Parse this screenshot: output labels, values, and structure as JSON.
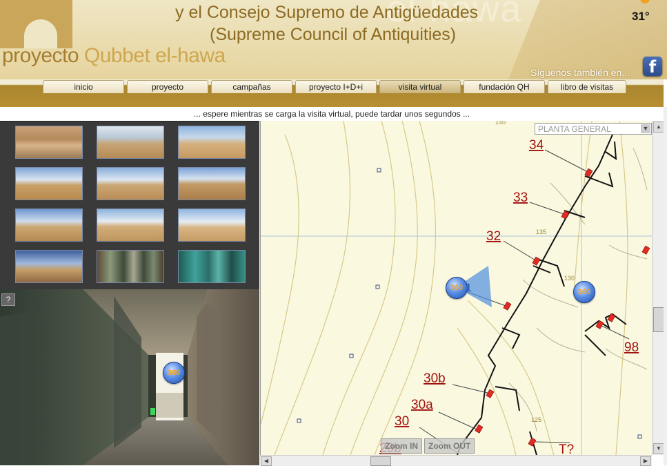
{
  "header": {
    "title_line1": "y el Consejo Supremo de Antigüedades",
    "title_line2": "(Supreme Council of Antiquities)",
    "logo_part1": "proyecto ",
    "logo_part2": "Qubbet el-hawa",
    "temperature": "31°",
    "follow_text": "Síguenos también en...",
    "facebook_glyph": "f"
  },
  "nav": {
    "tabs": [
      {
        "label": "inicio",
        "active": false
      },
      {
        "label": "proyecto",
        "active": false
      },
      {
        "label": "campañas",
        "active": false
      },
      {
        "label": "proyecto I+D+i",
        "active": false
      },
      {
        "label": "visita virtual",
        "active": true
      },
      {
        "label": "fundación QH",
        "active": false
      },
      {
        "label": "libro de visitas",
        "active": false
      }
    ]
  },
  "loading_message": "... espere mientras se carga la visita virtual, puede tardar unos segundos ...",
  "help_label": "?",
  "map": {
    "select_value": "PLANTA GENERAL",
    "tomb_labels": [
      "34",
      "33",
      "32",
      "98",
      "30b",
      "30a",
      "30",
      "29b",
      "T?"
    ],
    "contour_labels": [
      "135",
      "130",
      "125",
      "140"
    ],
    "pano_marker_label": "360",
    "pano_suffix": "1",
    "zoom_in": "Zoom IN",
    "zoom_out": "Zoom OUT"
  },
  "pano_marker_label": "360",
  "colors": {
    "header_bg": "#eadcae",
    "brand_gold": "#a67d2f",
    "nav_bar": "#b88f33",
    "map_bg": "#fbf8e0",
    "tomb_label": "#a1120f"
  }
}
